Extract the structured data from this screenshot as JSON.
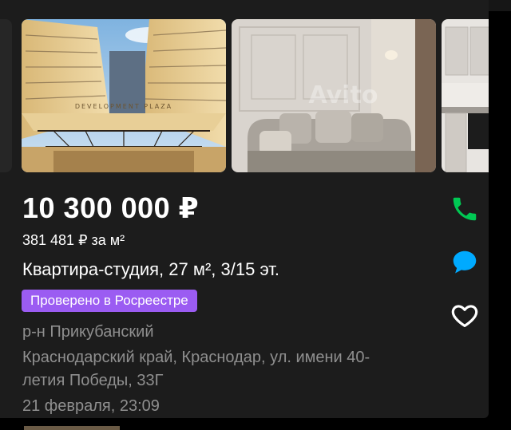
{
  "listing": {
    "price": "10 300 000 ₽",
    "price_per_meter": "381 481 ₽ за м²",
    "title": "Квартира-студия, 27 м², 3/15 эт.",
    "badge": "Проверено в Росреестре",
    "district": "р-н Прикубанский",
    "address_line1": "Краснодарский край, Краснодар, ул. имени 40-",
    "address_line2": "летия Победы, 33Г",
    "date": "21 февраля, 23:09"
  },
  "gallery": {
    "photo1_sign": "DEVELOPMENT PLAZA",
    "photo2_watermark": "Avito"
  },
  "actions": {
    "call_icon": "phone-icon",
    "chat_icon": "chat-icon",
    "favorite_icon": "heart-icon"
  },
  "colors": {
    "background": "#1c1c1c",
    "badge": "#9b5cf2",
    "call": "#00c853",
    "chat": "#00aaff",
    "secondary_text": "#8f8f8f"
  }
}
